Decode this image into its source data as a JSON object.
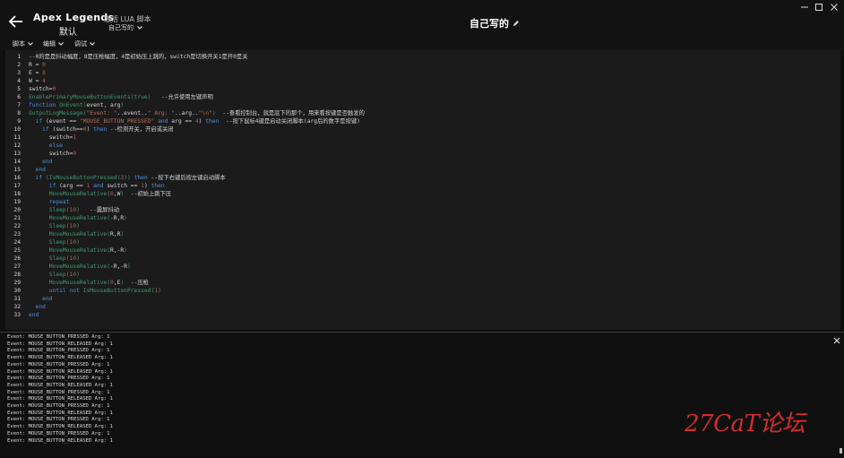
{
  "header": {
    "app_title": "Apex Legends",
    "profile_name": "默认",
    "lua_label": "激活 LUA 脚本",
    "script_selected": "自己写的",
    "doc_title": "自己写的"
  },
  "menu": [
    {
      "label": "脚本"
    },
    {
      "label": "编辑"
    },
    {
      "label": "调试"
    }
  ],
  "editor": {
    "line_numbers": [
      "1",
      "2",
      "3",
      "4",
      "5",
      "6",
      "7",
      "8",
      "9",
      "10",
      "11",
      "12",
      "13",
      "14",
      "15",
      "16",
      "17",
      "18",
      "19",
      "20",
      "21",
      "22",
      "23",
      "24",
      "25",
      "26",
      "27",
      "28",
      "29",
      "30",
      "31",
      "32",
      "33"
    ]
  },
  "output": {
    "lines": [
      "Event: MOUSE_BUTTON_PRESSED Arg: 1",
      "Event: MOUSE_BUTTON_RELEASED Arg: 1",
      "Event: MOUSE_BUTTON_PRESSED Arg: 1",
      "Event: MOUSE_BUTTON_RELEASED Arg: 1",
      "Event: MOUSE_BUTTON_PRESSED Arg: 1",
      "Event: MOUSE_BUTTON_RELEASED Arg: 1",
      "Event: MOUSE_BUTTON_PRESSED Arg: 1",
      "Event: MOUSE_BUTTON_RELEASED Arg: 1",
      "Event: MOUSE_BUTTON_PRESSED Arg: 1",
      "Event: MOUSE_BUTTON_RELEASED Arg: 1",
      "Event: MOUSE_BUTTON_PRESSED Arg: 1",
      "Event: MOUSE_BUTTON_RELEASED Arg: 1",
      "Event: MOUSE_BUTTON_PRESSED Arg: 1",
      "Event: MOUSE_BUTTON_RELEASED Arg: 1",
      "Event: MOUSE_BUTTON_PRESSED Arg: 1",
      "Event: MOUSE_BUTTON_RELEASED Arg: 1"
    ]
  },
  "watermark": "27CaT论坛",
  "colors": {
    "background": "#0f0f0f",
    "editor_bg": "#1b1b1b",
    "keyword": "#4d8fd6",
    "function": "#3f9a73",
    "string": "#b86f5a",
    "number": "#c35a5a",
    "watermark": "#d42c2c"
  },
  "icons": {
    "back": "arrow-left-icon",
    "edit": "pencil-icon",
    "dropdown": "chevron-down-icon",
    "minimize": "minimize-icon",
    "maximize": "maximize-icon",
    "close": "close-icon"
  }
}
